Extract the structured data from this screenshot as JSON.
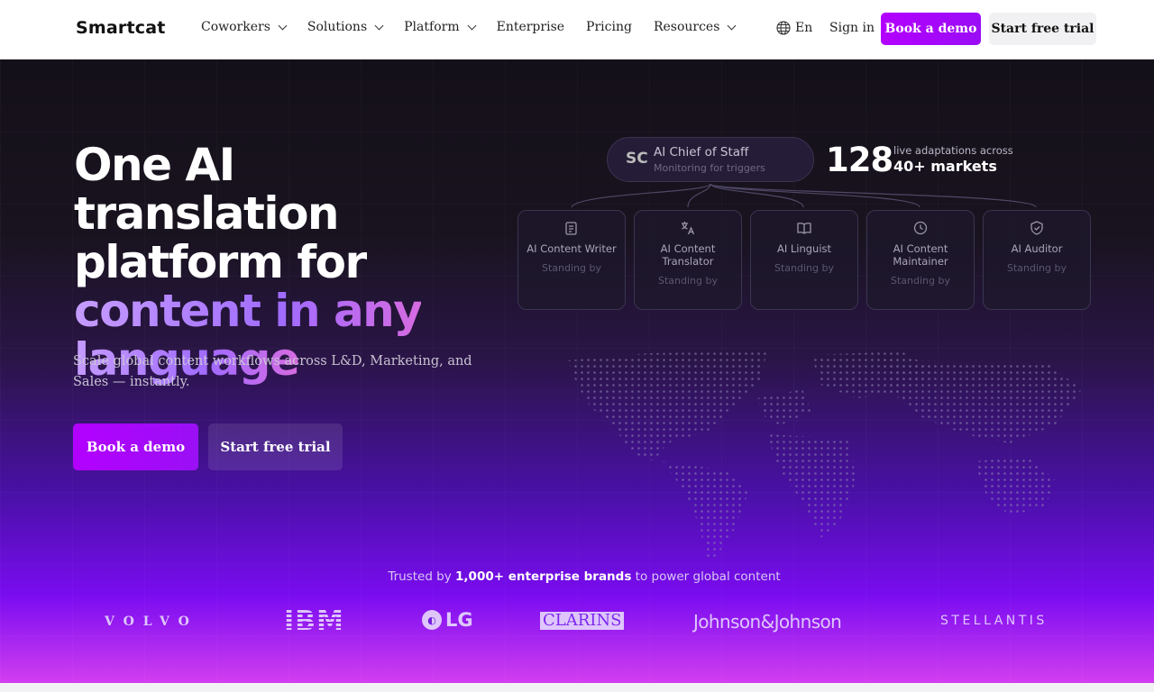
{
  "header": {
    "logo": "Smartcat",
    "nav": [
      {
        "label": "Coworkers",
        "has_dropdown": true
      },
      {
        "label": "Solutions",
        "has_dropdown": true
      },
      {
        "label": "Platform",
        "has_dropdown": true
      },
      {
        "label": "Enterprise",
        "has_dropdown": false
      },
      {
        "label": "Pricing",
        "has_dropdown": false
      },
      {
        "label": "Resources",
        "has_dropdown": true
      }
    ],
    "language": "En",
    "sign_in": "Sign in",
    "book_demo": "Book a demo",
    "start_trial": "Start free trial"
  },
  "hero": {
    "headline_line1": "One AI translation",
    "headline_line2": "platform for",
    "headline_accent1": "content in any",
    "headline_accent2": "language",
    "subtitle": "Scale global content workflows across L&D, Marketing, and Sales — instantly.",
    "book_demo": "Book a demo",
    "start_trial": "Start free trial"
  },
  "diagram": {
    "chief_title": "AI Chief of Staff",
    "chief_subtitle": "Monitoring for triggers",
    "chief_icon": "SC",
    "stat_number": "128",
    "stat_line1": "live adaptations across",
    "stat_line2": "40+ markets",
    "agents": [
      {
        "title": "AI Content Writer",
        "status": "Standing by",
        "icon": "edit-note-icon"
      },
      {
        "title": "AI Content Translator",
        "status": "Standing by",
        "icon": "translate-icon"
      },
      {
        "title": "AI Linguist",
        "status": "Standing by",
        "icon": "book-icon"
      },
      {
        "title": "AI Content Maintainer",
        "status": "Standing by",
        "icon": "refresh-clock-icon"
      },
      {
        "title": "AI Auditor",
        "status": "Standing by",
        "icon": "shield-check-icon"
      }
    ]
  },
  "trusted": {
    "prefix": "Trusted by",
    "highlight": "1,000+ enterprise brands",
    "suffix": "to power global content"
  },
  "brands": [
    "VOLVO",
    "IBM",
    "LG",
    "CLARINS",
    "Johnson&Johnson",
    "STELLANTIS"
  ],
  "colors": {
    "accent": "#a800ff",
    "hero_bg_top": "#141019",
    "hero_bg_bottom": "#d23ef0"
  }
}
